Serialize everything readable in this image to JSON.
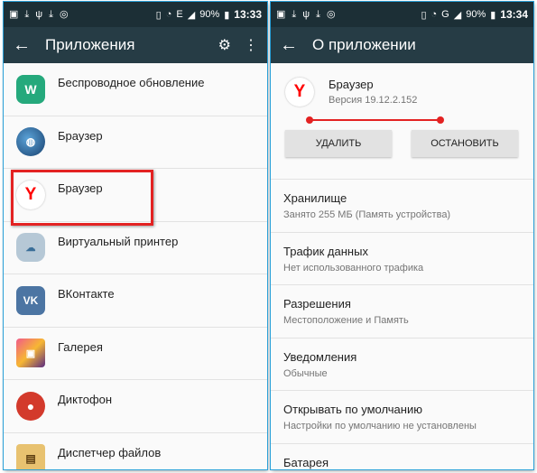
{
  "left": {
    "status": {
      "battery": "90%",
      "time": "13:33",
      "network": "E",
      "icons_left": [
        "image-icon",
        "download-icon",
        "usb-icon",
        "download-icon",
        "location-icon"
      ]
    },
    "appbar": {
      "back": "←",
      "title": "Приложения",
      "settings_icon": "⚙",
      "menu_icon": "⋮"
    },
    "apps": [
      {
        "label": "Беспроводное обновление",
        "icon": "update-icon",
        "glyph": "W"
      },
      {
        "label": "Браузер",
        "icon": "globe-browser-icon",
        "glyph": "◍"
      },
      {
        "label": "Браузер",
        "icon": "yandex-browser-icon",
        "glyph": "Y"
      },
      {
        "label": "Виртуальный принтер",
        "icon": "cloud-printer-icon",
        "glyph": "☁"
      },
      {
        "label": "ВКонтакте",
        "icon": "vk-icon",
        "glyph": "VK"
      },
      {
        "label": "Галерея",
        "icon": "gallery-icon",
        "glyph": "▣"
      },
      {
        "label": "Диктофон",
        "icon": "microphone-icon",
        "glyph": "●"
      },
      {
        "label": "Диспетчер файлов",
        "icon": "file-manager-icon",
        "glyph": "▤"
      }
    ],
    "highlight_color": "#e32222"
  },
  "right": {
    "status": {
      "battery": "90%",
      "time": "13:34",
      "network": "G",
      "icons_left": [
        "image-icon",
        "download-icon",
        "usb-icon",
        "download-icon",
        "location-icon"
      ]
    },
    "appbar": {
      "back": "←",
      "title": "О приложении"
    },
    "app": {
      "name": "Браузер",
      "version": "Версия 19.12.2.152",
      "glyph": "Y"
    },
    "buttons": {
      "uninstall": "УДАЛИТЬ",
      "stop": "ОСТАНОВИТЬ"
    },
    "settings": [
      {
        "title": "Хранилище",
        "subtitle": "Занято 255 МБ (Память устройства)"
      },
      {
        "title": "Трафик данных",
        "subtitle": "Нет использованного трафика"
      },
      {
        "title": "Разрешения",
        "subtitle": "Местоположение и Память"
      },
      {
        "title": "Уведомления",
        "subtitle": "Обычные"
      },
      {
        "title": "Открывать по умолчанию",
        "subtitle": "Настройки по умолчанию не установлены"
      },
      {
        "title": "Батарея",
        "subtitle": ""
      }
    ]
  },
  "colors": {
    "statusbar": "#1c2f36",
    "appbar": "#263c45",
    "accent_red": "#e32222"
  }
}
